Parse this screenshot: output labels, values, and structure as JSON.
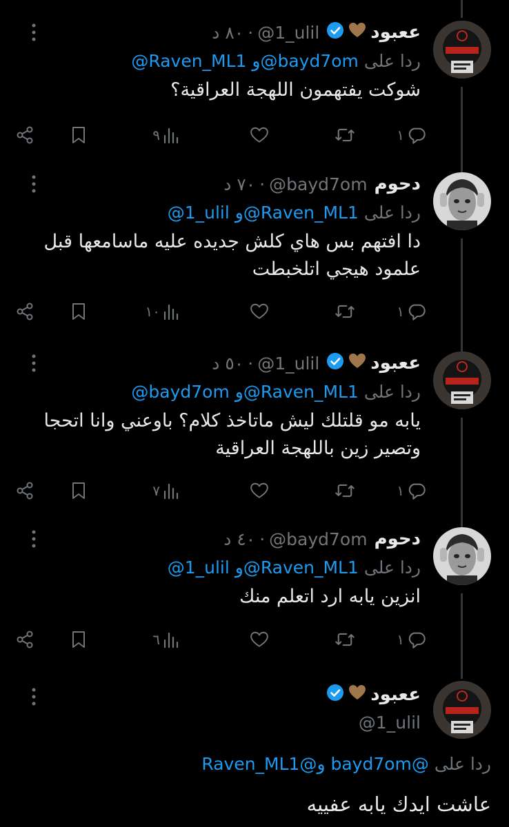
{
  "tweets": [
    {
      "name": "ععبود",
      "handle": "@1_ulil",
      "time": "٨٠ د",
      "reply_prefix": "ردا على",
      "mentions": "@Raven_ML1 و@bayd7om",
      "text": "شوكت يفتهمون اللهجة العراقية؟",
      "replies": "١",
      "views": "٩",
      "verified": true,
      "avatar": "red-hood-avatar"
    },
    {
      "name": "دحوم",
      "handle": "@bayd7om",
      "time": "٧٠ د",
      "reply_prefix": "ردا على",
      "mentions": "@1_ulil و@Raven_ML1",
      "text": "دا افتهم بس هاي كلش جديده عليه ماسامعها قبل علمود هيجي اتلخبطت",
      "replies": "١",
      "views": "١٠",
      "verified": false,
      "avatar": "girl-photo-avatar"
    },
    {
      "name": "ععبود",
      "handle": "@1_ulil",
      "time": "٥٠ د",
      "reply_prefix": "ردا على",
      "mentions": "@bayd7om و@Raven_ML1",
      "text": "يابه مو قلتلك ليش ماتاخذ كلام؟ باوعني وانا اتحجا وتصير زين باللهجة العراقية",
      "replies": "١",
      "views": "٧",
      "verified": true,
      "avatar": "red-hood-avatar"
    },
    {
      "name": "دحوم",
      "handle": "@bayd7om",
      "time": "٤٠ د",
      "reply_prefix": "ردا على",
      "mentions": "@1_ulil و@Raven_ML1",
      "text": "انزين يابه ارد اتعلم منك",
      "replies": "١",
      "views": "٦",
      "verified": false,
      "avatar": "girl-photo-avatar"
    }
  ],
  "focused": {
    "name": "ععبود",
    "handle": "@1_ulil",
    "reply_prefix": "ردا على",
    "mentions": "@bayd7om و@Raven_ML1",
    "text": "عاشت ايدك يابه عفييه",
    "verified": true,
    "avatar": "red-hood-avatar"
  },
  "separator": "·",
  "colors": {
    "background": "#000000",
    "text": "#e7e9ea",
    "muted": "#71767b",
    "link": "#1d9bf0",
    "verified": "#1d9bf0",
    "heart": "#a0774a"
  },
  "icons": [
    "reply-icon",
    "retweet-icon",
    "like-icon",
    "views-icon",
    "bookmark-icon",
    "share-icon",
    "more-icon",
    "verified-icon",
    "brown-heart-icon"
  ]
}
